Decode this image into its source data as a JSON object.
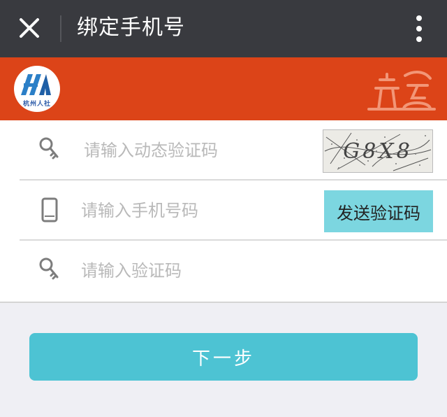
{
  "header": {
    "title": "绑定手机号",
    "close_icon": "close-icon",
    "more_icon": "more-vertical-icon"
  },
  "banner": {
    "logo_text": "杭州人社",
    "emblem_icon": "emblem-icon",
    "background_color": "#dc4418"
  },
  "form": {
    "captcha_placeholder": "请输入动态验证码",
    "captcha_image_text": "G8X8",
    "phone_placeholder": "请输入手机号码",
    "send_code_label": "发送验证码",
    "sms_code_placeholder": "请输入验证码",
    "key_icon": "key-icon",
    "phone_icon": "mobile-phone-icon"
  },
  "actions": {
    "next_label": "下一步",
    "accent_color": "#4dc3d3"
  }
}
